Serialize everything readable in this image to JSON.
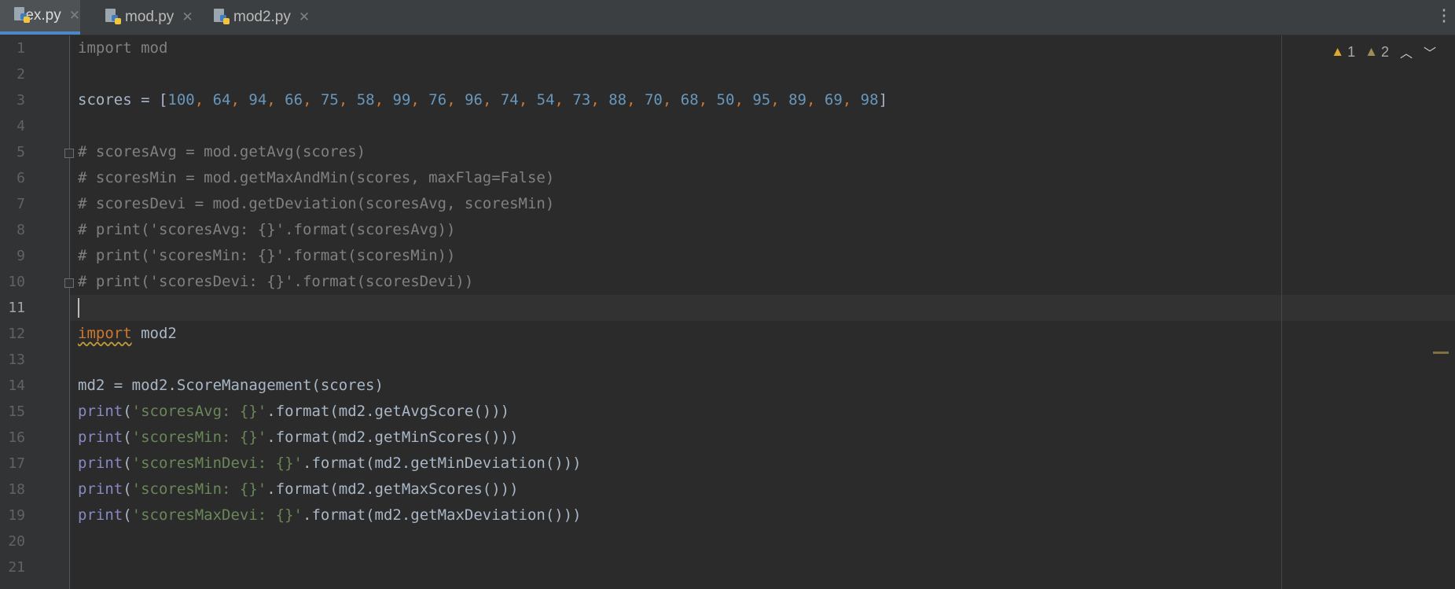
{
  "tabs": [
    {
      "label": "ex.py",
      "active": true
    },
    {
      "label": "mod.py",
      "active": false
    },
    {
      "label": "mod2.py",
      "active": false
    }
  ],
  "line_numbers": [
    "1",
    "2",
    "3",
    "4",
    "5",
    "6",
    "7",
    "8",
    "9",
    "10",
    "11",
    "12",
    "13",
    "14",
    "15",
    "16",
    "17",
    "18",
    "19",
    "20",
    "21"
  ],
  "current_line": 11,
  "code": {
    "l1": "import mod",
    "l3_a": "scores = [",
    "l3_nums": [
      "100",
      "64",
      "94",
      "66",
      "75",
      "58",
      "99",
      "76",
      "96",
      "74",
      "54",
      "73",
      "88",
      "70",
      "68",
      "50",
      "95",
      "89",
      "69",
      "98"
    ],
    "l3_b": "]",
    "l5": "# scoresAvg = mod.getAvg(scores)",
    "l6": "# scoresMin = mod.getMaxAndMin(scores, maxFlag=False)",
    "l7": "# scoresDevi = mod.getDeviation(scoresAvg, scoresMin)",
    "l8": "# print('scoresAvg: {}'.format(scoresAvg))",
    "l9": "# print('scoresMin: {}'.format(scoresMin))",
    "l10": "# print('scoresDevi: {}'.format(scoresDevi))",
    "l12_kw": "import",
    "l12_rest": " mod2",
    "l14": "md2 = mod2.ScoreManagement(scores)",
    "l15_fn": "print",
    "l15_open": "(",
    "l15_str": "'scoresAvg: {}'",
    "l15_rest": ".format(md2.getAvgScore()))",
    "l16_fn": "print",
    "l16_open": "(",
    "l16_str": "'scoresMin: {}'",
    "l16_rest": ".format(md2.getMinScores()))",
    "l17_fn": "print",
    "l17_open": "(",
    "l17_str": "'scoresMinDevi: {}'",
    "l17_rest": ".format(md2.getMinDeviation()))",
    "l18_fn": "print",
    "l18_open": "(",
    "l18_str": "'scoresMin: {}'",
    "l18_rest": ".format(md2.getMaxScores()))",
    "l19_fn": "print",
    "l19_open": "(",
    "l19_str": "'scoresMaxDevi: {}'",
    "l19_rest": ".format(md2.getMaxDeviation()))"
  },
  "inspections": {
    "warnings": "1",
    "weak_warnings": "2"
  },
  "colors": {
    "background": "#2b2b2b",
    "keyword": "#cc7832",
    "number": "#6897bb",
    "string": "#6a8759",
    "builtin": "#8888c6",
    "comment": "#808080",
    "warning": "#e0a82c"
  }
}
